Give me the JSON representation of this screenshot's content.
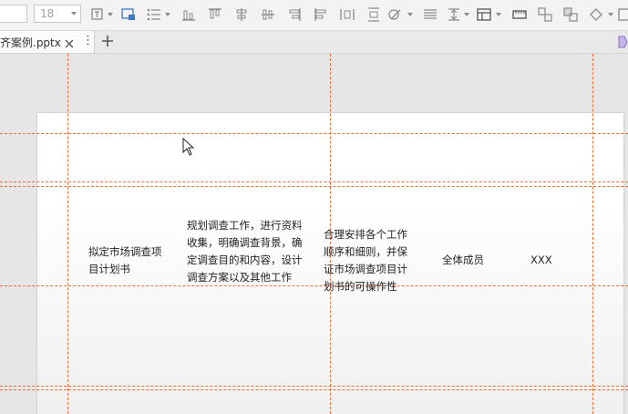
{
  "toolbar": {
    "font_size": "18"
  },
  "tab": {
    "title": "齐案例.pptx",
    "more": "⋮",
    "add": "+"
  },
  "table_row": {
    "task": "拟定市场调查项目计划书",
    "content": "规划调查工作，进行资料收集，明确调查背景，确定调查目的和内容，设计调查方案以及其他工作",
    "requirement": "合理安排各个工作顺序和细则，并保证市场调查项目计划书的可操作性",
    "owner": "全体成员",
    "note": "XXX"
  },
  "colors": {
    "guide": "#e8703c",
    "toolbar_bg": "#f3f3f3",
    "canvas_bg": "#e6e6e6"
  }
}
